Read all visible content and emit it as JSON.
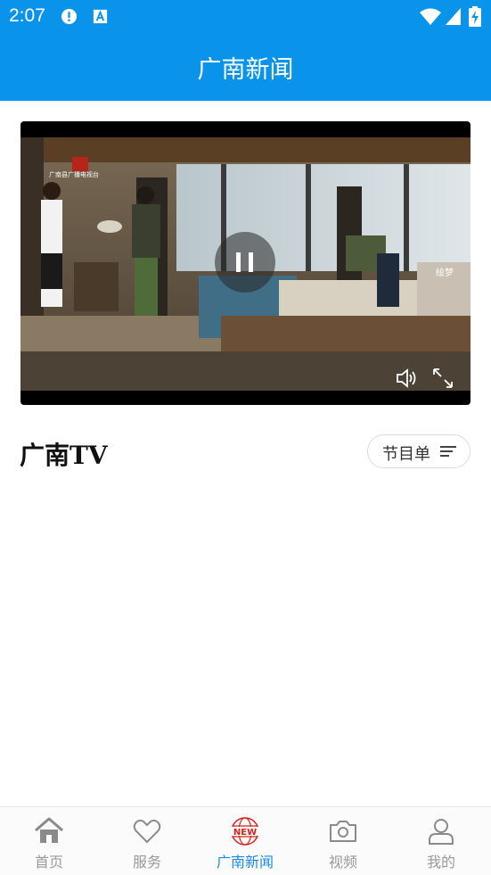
{
  "status_bar": {
    "time": "2:07"
  },
  "header": {
    "title": "广南新闻"
  },
  "video": {
    "channel_logo_text": "广南县广播电视台",
    "watermark_text": "绘梦"
  },
  "tv": {
    "heading": "广南TV",
    "schedule_label": "节目单"
  },
  "nav": {
    "items": [
      {
        "label": "首页",
        "icon": "home-icon"
      },
      {
        "label": "服务",
        "icon": "heart-icon"
      },
      {
        "label": "广南新闻",
        "icon": "news-globe-icon",
        "badge": "NEW"
      },
      {
        "label": "视频",
        "icon": "camera-icon"
      },
      {
        "label": "我的",
        "icon": "person-icon"
      }
    ],
    "active_index": 2
  },
  "colors": {
    "brand": "#0a93ea",
    "active": "#1a8be0",
    "inactive": "#999999",
    "news_red": "#d4241c"
  }
}
